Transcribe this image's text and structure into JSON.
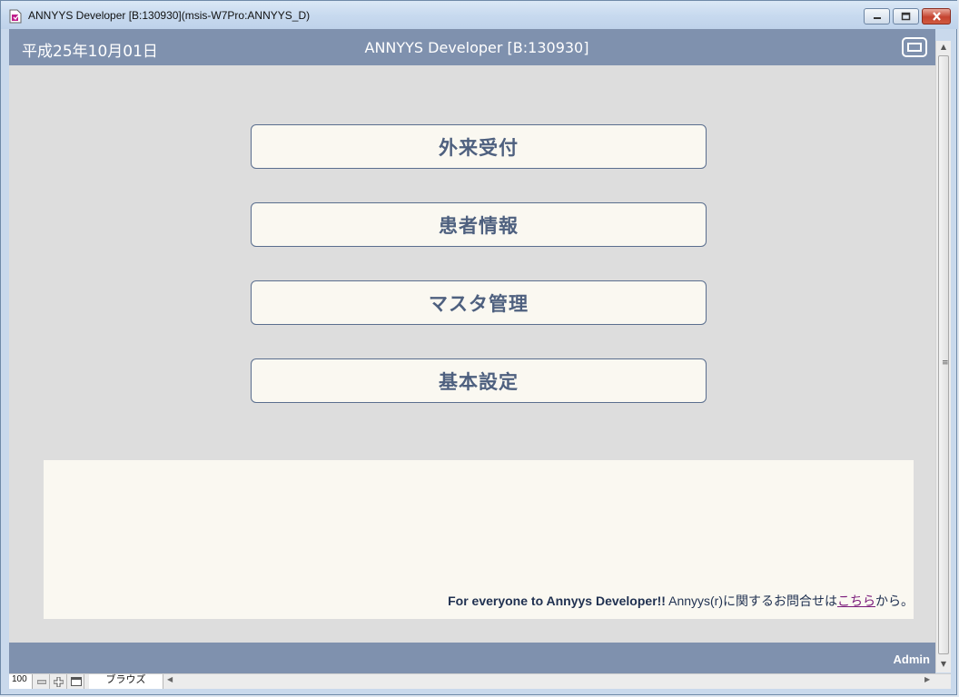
{
  "window": {
    "title": "ANNYYS Developer [B:130930](msis-W7Pro:ANNYYS_D)"
  },
  "header": {
    "date": "平成25年10月01日",
    "title": "ANNYYS Developer [B:130930]"
  },
  "menu": {
    "items": [
      {
        "label": "外来受付"
      },
      {
        "label": "患者情報"
      },
      {
        "label": "マスタ管理"
      },
      {
        "label": "基本設定"
      }
    ]
  },
  "notice": {
    "bold_text": "For everyone to Annyys Developer!!",
    "text_before_link": " Annyys(r)に関するお問合せは",
    "link_text": "こちら",
    "text_after_link": "から。"
  },
  "footer": {
    "user": "Admin"
  },
  "statusbar": {
    "zoom": "100",
    "mode": "ブラウズ"
  },
  "colors": {
    "header_bg": "#7f91ae",
    "button_text": "#4e607f",
    "panel_bg": "#faf8f1"
  }
}
